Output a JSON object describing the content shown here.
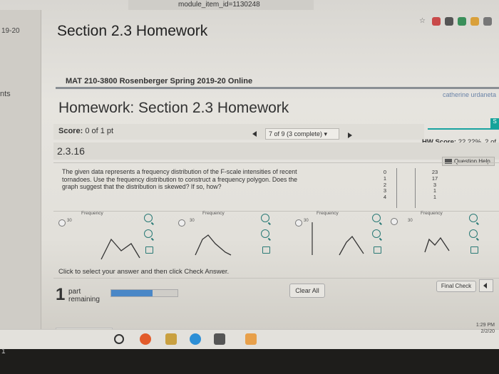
{
  "browser": {
    "url_fragment": "module_item_id=1130248"
  },
  "left_strip": {
    "date": "19-20",
    "label": "nts",
    "bottom_num": "1"
  },
  "page": {
    "section_title": "Section 2.3 Homework",
    "course": "MAT 210-3800 Rosenberger Spring 2019-20 Online",
    "user": "catherine urdaneta",
    "hw_title": "Homework: Section 2.3 Homework"
  },
  "score_bar": {
    "score_label": "Score:",
    "score_value": "0 of 1 pt",
    "nav_status": "7 of 9 (3 complete)",
    "hw_score_label": "HW Score:",
    "hw_score_value": "22.22%, 2 of"
  },
  "question": {
    "number": "2.3.16",
    "help_label": "Question Help",
    "text": "The given data represents a frequency distribution of the F-scale intensities of recent tornadoes. Use the frequency distribution to construct a frequency polygon. Does the graph suggest that the distribution is skewed? If so, how?",
    "table": {
      "values": [
        "0",
        "1",
        "2",
        "3",
        "4"
      ],
      "frequencies": [
        "23",
        "17",
        "3",
        "1",
        "1"
      ]
    }
  },
  "options": [
    {
      "id": "A",
      "ylabel": "Frequency",
      "ytick": "30"
    },
    {
      "id": "B",
      "ylabel": "Frequency",
      "ytick": "30"
    },
    {
      "id": "C",
      "ylabel": "Frequency",
      "ytick": "30"
    },
    {
      "id": "D",
      "ylabel": "Frequency",
      "ytick": "30"
    }
  ],
  "footer": {
    "instruction": "Click to select your answer and then click Check Answer.",
    "parts_count": "1",
    "parts_label_1": "part",
    "parts_label_2": "remaining",
    "progress": 0.62,
    "clear_label": "Clear All",
    "final_label": "Final Check"
  },
  "taskbar": {
    "time": "1:29 PM",
    "date": "2/2/20"
  },
  "colors": {
    "accent": "#16a39a",
    "progress": "#4a87c7",
    "icon": "#2a7a76"
  }
}
